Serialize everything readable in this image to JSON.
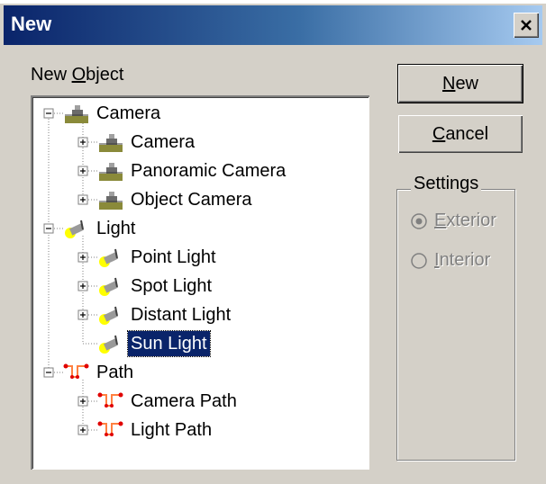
{
  "window": {
    "title": "New",
    "close_icon": "close-icon"
  },
  "new_object_label": {
    "before": "New ",
    "accel": "O",
    "after": "bject"
  },
  "tree": {
    "nodes": [
      {
        "label": "Camera",
        "icon": "camera-icon",
        "depth": 0,
        "expanded": true
      },
      {
        "label": "Camera",
        "icon": "camera-icon",
        "depth": 1,
        "expanded": false
      },
      {
        "label": "Panoramic Camera",
        "icon": "camera-icon",
        "depth": 1,
        "expanded": false
      },
      {
        "label": "Object Camera",
        "icon": "camera-icon",
        "depth": 1,
        "expanded": false
      },
      {
        "label": "Light",
        "icon": "light-icon",
        "depth": 0,
        "expanded": true
      },
      {
        "label": "Point Light",
        "icon": "light-icon",
        "depth": 1,
        "expanded": false
      },
      {
        "label": "Spot Light",
        "icon": "light-icon",
        "depth": 1,
        "expanded": false
      },
      {
        "label": "Distant Light",
        "icon": "light-icon",
        "depth": 1,
        "expanded": false
      },
      {
        "label": "Sun Light",
        "icon": "light-icon",
        "depth": 1,
        "selected": true
      },
      {
        "label": "Path",
        "icon": "path-icon",
        "depth": 0,
        "expanded": true
      },
      {
        "label": "Camera Path",
        "icon": "path-icon",
        "depth": 1,
        "expanded": false
      },
      {
        "label": "Light Path",
        "icon": "path-icon",
        "depth": 1,
        "expanded": false
      }
    ]
  },
  "buttons": {
    "new": {
      "accel": "N",
      "rest": "ew"
    },
    "cancel": {
      "accel": "C",
      "rest": "ancel"
    }
  },
  "settings": {
    "title": "Settings",
    "exterior": {
      "accel": "E",
      "rest": "xterior",
      "checked": true,
      "enabled": false
    },
    "interior": {
      "accel": "I",
      "rest": "nterior",
      "checked": false,
      "enabled": false
    }
  },
  "colors": {
    "selection": "#0a246a",
    "face": "#d4d0c8",
    "title_start": "#0a246a"
  }
}
